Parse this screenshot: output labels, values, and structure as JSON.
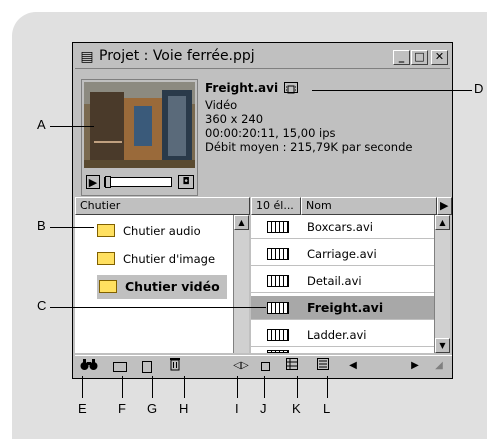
{
  "window": {
    "title": "Projet : Voie ferrée.ppj",
    "minimize_label": "_",
    "maximize_label": "□",
    "close_label": "✕"
  },
  "clip": {
    "name": "Freight.avi",
    "type": "Vidéo",
    "dimensions": "360 x 240",
    "duration": "00:00:20:11, 15,00 ips",
    "data_rate": "Débit moyen : 215,79K par seconde"
  },
  "columns": {
    "bins": "Chutier",
    "count": "10 él...",
    "name": "Nom"
  },
  "bins": [
    {
      "label": "Chutier audio"
    },
    {
      "label": "Chutier d'image"
    },
    {
      "label": "Chutier vidéo"
    }
  ],
  "files": [
    {
      "label": "Boxcars.avi"
    },
    {
      "label": "Carriage.avi"
    },
    {
      "label": "Detail.avi"
    },
    {
      "label": "Freight.avi"
    },
    {
      "label": "Ladder.avi"
    }
  ],
  "callouts": {
    "A": "A",
    "B": "B",
    "C": "C",
    "D": "D",
    "E": "E",
    "F": "F",
    "G": "G",
    "H": "H",
    "I": "I",
    "J": "J",
    "K": "K",
    "L": "L"
  }
}
